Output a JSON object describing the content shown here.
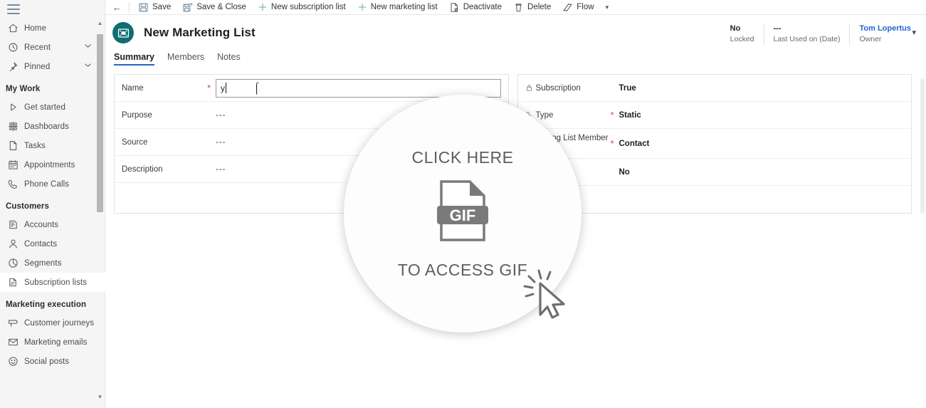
{
  "sidebar": {
    "menu_icon": "hamburger-icon",
    "items": [
      {
        "label": "Home",
        "icon": "home-icon",
        "type": "item",
        "chevron": false,
        "selected": false
      },
      {
        "label": "Recent",
        "icon": "clock-icon",
        "type": "item",
        "chevron": true,
        "selected": false
      },
      {
        "label": "Pinned",
        "icon": "pin-icon",
        "type": "item",
        "chevron": true,
        "selected": false
      },
      {
        "label": "My Work",
        "icon": "",
        "type": "group"
      },
      {
        "label": "Get started",
        "icon": "play-icon",
        "type": "item",
        "chevron": false,
        "selected": false
      },
      {
        "label": "Dashboards",
        "icon": "dashboard-icon",
        "type": "item",
        "chevron": false,
        "selected": false
      },
      {
        "label": "Tasks",
        "icon": "task-icon",
        "type": "item",
        "chevron": false,
        "selected": false
      },
      {
        "label": "Appointments",
        "icon": "calendar-icon",
        "type": "item",
        "chevron": false,
        "selected": false
      },
      {
        "label": "Phone Calls",
        "icon": "phone-icon",
        "type": "item",
        "chevron": false,
        "selected": false
      },
      {
        "label": "Customers",
        "icon": "",
        "type": "group"
      },
      {
        "label": "Accounts",
        "icon": "account-icon",
        "type": "item",
        "chevron": false,
        "selected": false
      },
      {
        "label": "Contacts",
        "icon": "contact-icon",
        "type": "item",
        "chevron": false,
        "selected": false
      },
      {
        "label": "Segments",
        "icon": "segment-icon",
        "type": "item",
        "chevron": false,
        "selected": false
      },
      {
        "label": "Subscription lists",
        "icon": "list-icon",
        "type": "item",
        "chevron": false,
        "selected": true
      },
      {
        "label": "Marketing execution",
        "icon": "",
        "type": "group"
      },
      {
        "label": "Customer journeys",
        "icon": "journey-icon",
        "type": "item",
        "chevron": false,
        "selected": false
      },
      {
        "label": "Marketing emails",
        "icon": "envelope-icon",
        "type": "item",
        "chevron": false,
        "selected": false
      },
      {
        "label": "Social posts",
        "icon": "social-icon",
        "type": "item",
        "chevron": false,
        "selected": false
      }
    ]
  },
  "commandbar": {
    "back_icon": "back-arrow-icon",
    "buttons": [
      {
        "label": "Save",
        "icon": "save-icon",
        "color": "blue"
      },
      {
        "label": "Save & Close",
        "icon": "save-close-icon",
        "color": "blue"
      },
      {
        "label": "New subscription list",
        "icon": "plus-icon",
        "color": "green"
      },
      {
        "label": "New marketing list",
        "icon": "plus-icon",
        "color": "green"
      },
      {
        "label": "Deactivate",
        "icon": "deactivate-icon",
        "color": "grey"
      },
      {
        "label": "Delete",
        "icon": "trash-icon",
        "color": "grey"
      },
      {
        "label": "Flow",
        "icon": "flow-icon",
        "color": "grey"
      }
    ],
    "overflow_icon": "chevron-down-icon"
  },
  "header": {
    "entity_icon": "marketing-list-icon",
    "title": "New Marketing List",
    "stats": [
      {
        "value": "No",
        "label": "Locked",
        "link": false
      },
      {
        "value": "---",
        "label": "Last Used on (Date)",
        "link": false
      },
      {
        "value": "Tom Lopertus",
        "label": "Owner",
        "link": true
      }
    ],
    "expand_icon": "chevron-down-icon"
  },
  "tabs": [
    {
      "label": "Summary",
      "active": true
    },
    {
      "label": "Members",
      "active": false
    },
    {
      "label": "Notes",
      "active": false
    }
  ],
  "form": {
    "left_column": [
      {
        "label": "Name",
        "required": true,
        "value": "y",
        "type": "input",
        "locked": false
      },
      {
        "label": "Purpose",
        "required": false,
        "value": "---",
        "type": "text",
        "locked": false
      },
      {
        "label": "Source",
        "required": false,
        "value": "---",
        "type": "text",
        "locked": false
      },
      {
        "label": "Description",
        "required": false,
        "value": "---",
        "type": "text",
        "locked": false
      },
      {
        "label": "",
        "required": false,
        "value": "",
        "type": "text",
        "locked": false
      }
    ],
    "right_column": [
      {
        "label": "Subscription",
        "required": false,
        "value": "True",
        "type": "text",
        "locked": true
      },
      {
        "label": "Type",
        "required": true,
        "value": "Static",
        "type": "text",
        "locked": true
      },
      {
        "label": "Marketing List Member Type",
        "required": true,
        "value": "Contact",
        "type": "text",
        "locked": false
      },
      {
        "label": "",
        "required": false,
        "value": "No",
        "type": "text",
        "locked": false
      },
      {
        "label": "",
        "required": false,
        "value": "",
        "type": "text",
        "locked": false
      }
    ]
  },
  "overlay": {
    "top_text": "CLICK HERE",
    "file_badge": "GIF",
    "bottom_text": "TO ACCESS GIF",
    "cursor_icon": "click-cursor-icon"
  },
  "colors": {
    "entity_accent": "#0e6e72",
    "tab_active_underline": "#2b62c8",
    "required_asterisk": "#c4503c",
    "link": "#2266cc",
    "plus_green": "#6aab7c",
    "save_blue": "#6f8ba4"
  }
}
